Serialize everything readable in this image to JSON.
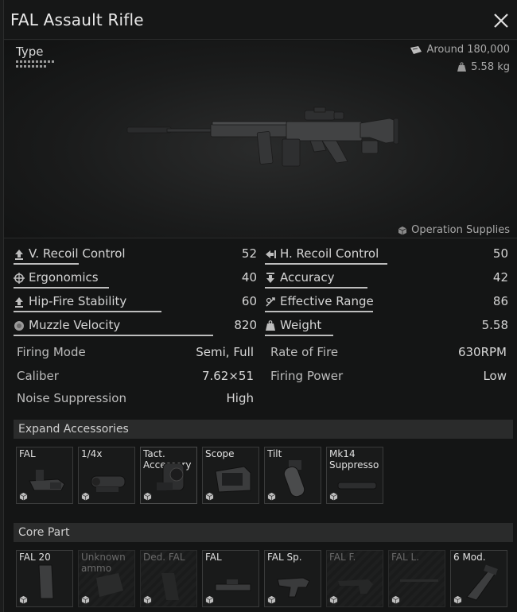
{
  "window": {
    "title": "FAL Assault Rifle"
  },
  "preview": {
    "type_label": "Type",
    "price": "Around 180,000",
    "weight": "5.58 kg",
    "source": "Operation Supplies"
  },
  "stats": {
    "v_recoil": {
      "label": "V. Recoil Control",
      "value": "52",
      "fill": 0.52
    },
    "h_recoil": {
      "label": "H. Recoil Control",
      "value": "50",
      "fill": 0.5
    },
    "ergonomics": {
      "label": "Ergonomics",
      "value": "40",
      "fill": 0.4
    },
    "accuracy": {
      "label": "Accuracy",
      "value": "42",
      "fill": 0.42
    },
    "hipfire": {
      "label": "Hip-Fire Stability",
      "value": "60",
      "fill": 0.6
    },
    "range": {
      "label": "Effective Range",
      "value": "86",
      "fill": 0.52
    },
    "muzzle": {
      "label": "Muzzle Velocity",
      "value": "820",
      "fill": 0.82
    },
    "weight": {
      "label": "Weight",
      "value": "5.58",
      "fill": 0.2
    }
  },
  "info": {
    "firing_mode": {
      "label": "Firing Mode",
      "value": "Semi, Full"
    },
    "rate_of_fire": {
      "label": "Rate of Fire",
      "value": "630RPM"
    },
    "caliber": {
      "label": "Caliber",
      "value": "7.62×51"
    },
    "firing_power": {
      "label": "Firing Power",
      "value": "Low"
    },
    "noise": {
      "label": "Noise Suppression",
      "value": "High"
    }
  },
  "accessories": {
    "header": "Expand Accessories",
    "slots": [
      {
        "label": "FAL",
        "icon": "mount-icon"
      },
      {
        "label": "1/4x",
        "icon": "optic-icon"
      },
      {
        "label": "Tact. Accessory",
        "icon": "tactical-icon"
      },
      {
        "label": "Scope",
        "icon": "holo-sight-icon"
      },
      {
        "label": "Tilt",
        "icon": "grip-icon"
      },
      {
        "label": "Mk14 Suppresso",
        "icon": "suppressor-icon"
      }
    ]
  },
  "core": {
    "header": "Core Part",
    "slots": [
      {
        "label": "FAL 20",
        "icon": "magazine-icon",
        "dim": false
      },
      {
        "label": "Unknown ammo",
        "icon": "ammo-icon",
        "dim": true
      },
      {
        "label": "Ded. FAL",
        "icon": "magazine-icon",
        "dim": true
      },
      {
        "label": "FAL",
        "icon": "receiver-icon",
        "dim": false
      },
      {
        "label": "FAL Sp.",
        "icon": "handguard-icon",
        "dim": false
      },
      {
        "label": "FAL F.",
        "icon": "frame-icon",
        "dim": true
      },
      {
        "label": "FAL L.",
        "icon": "barrel-icon",
        "dim": true
      },
      {
        "label": "6 Mod.",
        "icon": "stock-icon",
        "dim": false
      }
    ]
  },
  "colors": {
    "bar": "#bdbdbd",
    "panel": "#141515",
    "section": "#2a2b2b"
  }
}
